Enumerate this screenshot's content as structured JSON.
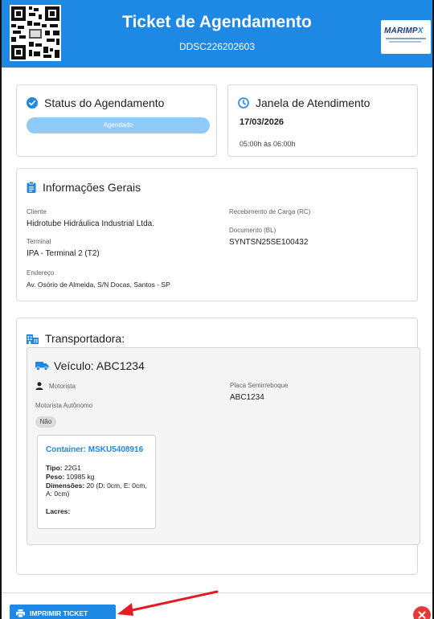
{
  "header": {
    "title": "Ticket de Agendamento",
    "code": "DDSC226202603",
    "logo_text_a": "MARIMP",
    "logo_text_b": "X",
    "primary_color": "#1e88e5"
  },
  "status": {
    "heading": "Status do Agendamento",
    "value": "Agendado",
    "icon": "check-circle-icon"
  },
  "window": {
    "heading": "Janela de Atendimento",
    "date": "17/03/2026",
    "time": "05:00h às 06:00h",
    "icon": "clock-icon"
  },
  "general": {
    "heading": "Informações Gerais",
    "icon": "clipboard-icon",
    "client_label": "Cliente",
    "client_value": "Hidrotube Hidráulica Industrial Ltda.",
    "terminal_label": "Terminal",
    "terminal_value": "IPA - Terminal 2 (T2)",
    "address_label": "Endereço",
    "address_value": "Av. Osório de Almeida, S/N Docas, Santos - SP",
    "rc_label": "Recebimento de Carga (RC)",
    "bl_label": "Documento (BL)",
    "bl_value": "SYNTSN25SE100432"
  },
  "carrier": {
    "heading": "Transportadora:",
    "icon": "building-icon",
    "vehicle_title": "Veículo: ABC1234",
    "driver_label": "Motorista",
    "autonomous_label": "Motorista Autônomo",
    "autonomous_value": "Não",
    "trailer_label": "Placa Semirreboque",
    "trailer_value": "ABC1234",
    "container": {
      "title": "Container: MSKU5408916",
      "type_label": "Tipo:",
      "type_value": "22G1",
      "weight_label": "Peso:",
      "weight_value": "10985 kg",
      "dims_label": "Dimensões:",
      "dims_value": "20 (D: 0cm, E: 0cm, A: 0cm)",
      "seals_label": "Lacres:"
    }
  },
  "footer": {
    "print_label": "IMPRIMIR TICKET",
    "close_color": "#e53935",
    "arrow_color": "#e31b23"
  }
}
